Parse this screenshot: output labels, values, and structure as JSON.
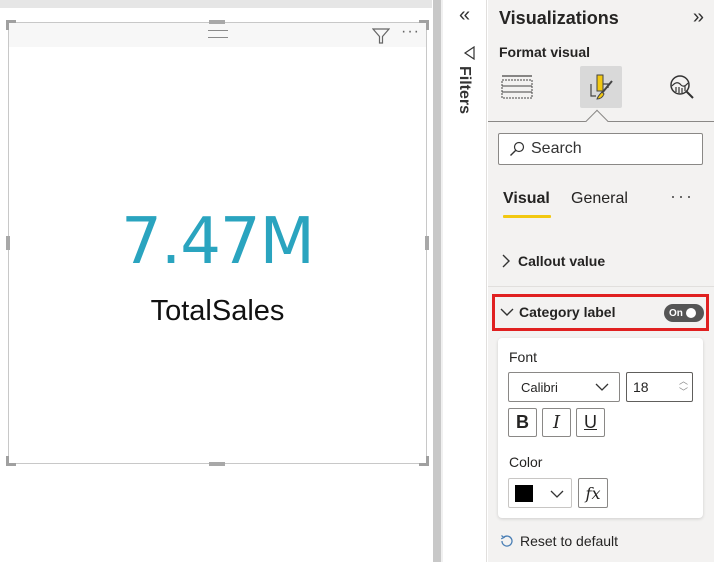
{
  "canvas": {
    "kpi_card": {
      "value": "7.47M",
      "label": "TotalSales",
      "value_color": "#2aa4bf",
      "header_icons": [
        "drag-grip-icon",
        "filter-icon",
        "more-options-icon"
      ],
      "more_label": "···"
    }
  },
  "filters_pane": {
    "collapse_icon": "«",
    "label": "Filters"
  },
  "visualizations_pane": {
    "title": "Visualizations",
    "expand_icon": "»",
    "subtitle": "Format visual",
    "tabs": [
      {
        "name": "build-visual",
        "icon": "fields-grid-icon",
        "active": false
      },
      {
        "name": "format-visual",
        "icon": "paint-brush-icon",
        "active": true
      },
      {
        "name": "analytics",
        "icon": "analytics-magnifier-icon",
        "active": false
      }
    ],
    "search": {
      "placeholder": "Search",
      "value": ""
    },
    "subtabs": [
      {
        "label": "Visual",
        "active": true
      },
      {
        "label": "General",
        "active": false
      }
    ],
    "more_label": "···",
    "sections": {
      "callout_value": {
        "label": "Callout value",
        "expanded": false
      },
      "category_label": {
        "label": "Category label",
        "expanded": true,
        "toggle": {
          "label": "On",
          "state": true
        },
        "font": {
          "label": "Font",
          "family": "Calibri",
          "size": "18",
          "bold": "B",
          "italic": "I",
          "underline": "U"
        },
        "color": {
          "label": "Color",
          "value": "#000000",
          "fx_label": "fx"
        }
      }
    },
    "reset_label": "Reset to default",
    "highlight_color": "#e02020",
    "accent_color": "#f2c811"
  }
}
